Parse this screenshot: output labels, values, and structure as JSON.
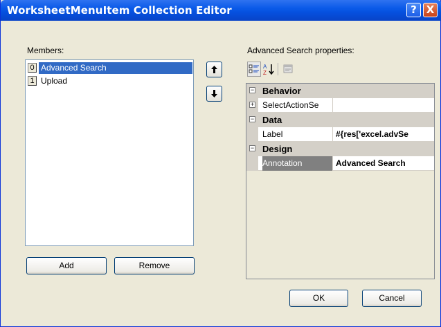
{
  "window": {
    "title": "WorksheetMenuItem Collection Editor",
    "help_glyph": "?",
    "close_glyph": "X"
  },
  "members": {
    "label": "Members:",
    "items": [
      {
        "index": "0",
        "name": "Advanced Search",
        "selected": true
      },
      {
        "index": "1",
        "name": "Upload",
        "selected": false
      }
    ],
    "move_up_icon": "arrow-up-icon",
    "move_down_icon": "arrow-down-icon",
    "add_label": "Add",
    "remove_label": "Remove"
  },
  "properties": {
    "label": "Advanced Search properties:",
    "toolbar_icons": [
      "categorized-icon",
      "alphabetical-icon",
      "property-pages-icon"
    ],
    "groups": [
      {
        "category": "Behavior",
        "expanded": true,
        "props": [
          {
            "name": "SelectActionSe",
            "value": "",
            "expandable": true
          }
        ]
      },
      {
        "category": "Data",
        "expanded": true,
        "props": [
          {
            "name": "Label",
            "value": "#{res['excel.advSe",
            "expandable": false
          }
        ]
      },
      {
        "category": "Design",
        "expanded": true,
        "props": [
          {
            "name": "Annotation",
            "value": "Advanced Search",
            "expandable": false,
            "selected": true
          }
        ]
      }
    ]
  },
  "footer": {
    "ok_label": "OK",
    "cancel_label": "Cancel"
  },
  "colors": {
    "titlebar": "#0a5ae8",
    "selection": "#316ac5",
    "dialog_bg": "#ece9d8"
  }
}
